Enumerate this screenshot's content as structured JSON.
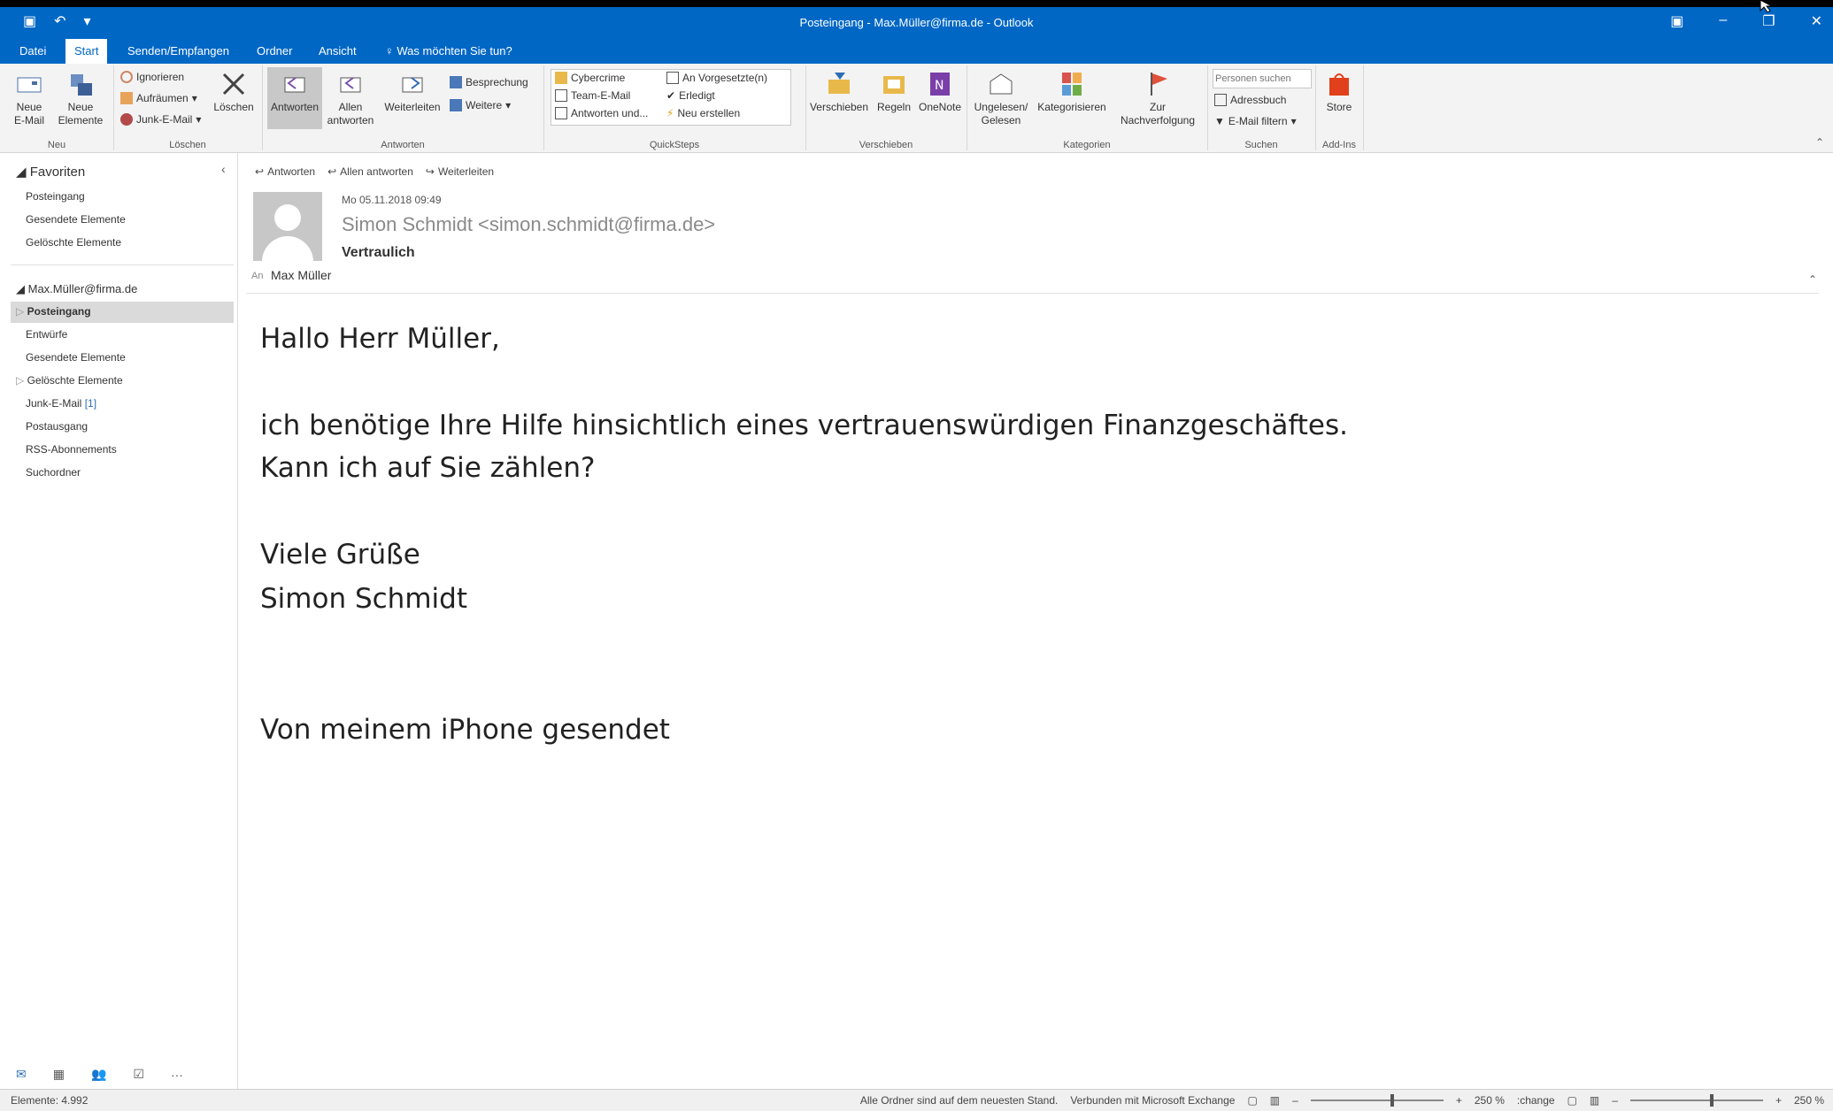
{
  "titlebar": {
    "title": "Posteingang - Max.Müller@firma.de    - Outlook"
  },
  "tabs": [
    "Datei",
    "Start",
    "Senden/Empfangen",
    "Ordner",
    "Ansicht"
  ],
  "tellme": "Was möchten Sie tun?",
  "ribbon": {
    "neu": {
      "neue_email": "Neue",
      "neue_email2": "E-Mail",
      "neue_elemente": "Neue",
      "neue_elemente2": "Elemente",
      "label": "Neu"
    },
    "loeschen": {
      "ignorieren": "Ignorieren",
      "aufraeumen": "Aufräumen",
      "junk": "Junk-E-Mail",
      "loeschen": "Löschen",
      "label": "Löschen"
    },
    "antworten": {
      "antworten": "Antworten",
      "allen": "Allen",
      "allen2": "antworten",
      "weiterleiten": "Weiterleiten",
      "besprechung": "Besprechung",
      "weitere": "Weitere",
      "label": "Antworten"
    },
    "quicksteps": {
      "items": [
        "Cybercrime",
        "Team-E-Mail",
        "Antworten und...",
        "An Vorgesetzte(n)",
        "Erledigt",
        "Neu erstellen"
      ],
      "label": "QuickSteps"
    },
    "verschieben": {
      "verschieben": "Verschieben",
      "regeln": "Regeln",
      "onenote": "OneNote",
      "label": "Verschieben"
    },
    "kategorien": {
      "ungelesen": "Ungelesen/",
      "gelesen": "Gelesen",
      "kategorisieren": "Kategorisieren",
      "zur": "Zur",
      "nachverfolgung": "Nachverfolgung",
      "label": "Kategorien"
    },
    "suchen": {
      "placeholder": "Personen suchen",
      "adressbuch": "Adressbuch",
      "filter": "E-Mail filtern",
      "label": "Suchen"
    },
    "addins": {
      "store": "Store",
      "label": "Add-Ins"
    }
  },
  "nav": {
    "favoriten": "Favoriten",
    "fav_items": [
      "Posteingang",
      "Gesendete Elemente",
      "Gelöschte Elemente"
    ],
    "account": "Max.Müller@firma.de",
    "folders": [
      "Posteingang",
      "Entwürfe",
      "Gesendete Elemente",
      "Gelöschte Elemente",
      "Junk-E-Mail",
      "Postausgang",
      "RSS-Abonnements",
      "Suchordner"
    ],
    "junk_count": "[1]"
  },
  "message": {
    "actions": [
      "Antworten",
      "Allen antworten",
      "Weiterleiten"
    ],
    "date": "Mo 05.11.2018 09:49",
    "from": "Simon Schmidt <simon.schmidt@firma.de>",
    "subject": "Vertraulich",
    "to_label": "An",
    "to": "Max Müller",
    "body": [
      "Hallo Herr Müller,",
      "ich benötige Ihre Hilfe hinsichtlich eines vertrauenswürdigen Finanzgeschäftes.",
      "Kann ich auf Sie zählen?",
      "Viele Grüße",
      "Simon Schmidt",
      "Von meinem iPhone gesendet"
    ]
  },
  "status": {
    "left": "Elemente: 4.992",
    "sync": "Alle Ordner sind auf dem neuesten Stand.",
    "connection": "Verbunden mit Microsoft Exchange",
    "zoom": "250 %",
    "zoom2": "250 %",
    "change": ":change"
  },
  "colors": {
    "accent": "#0067c5"
  }
}
